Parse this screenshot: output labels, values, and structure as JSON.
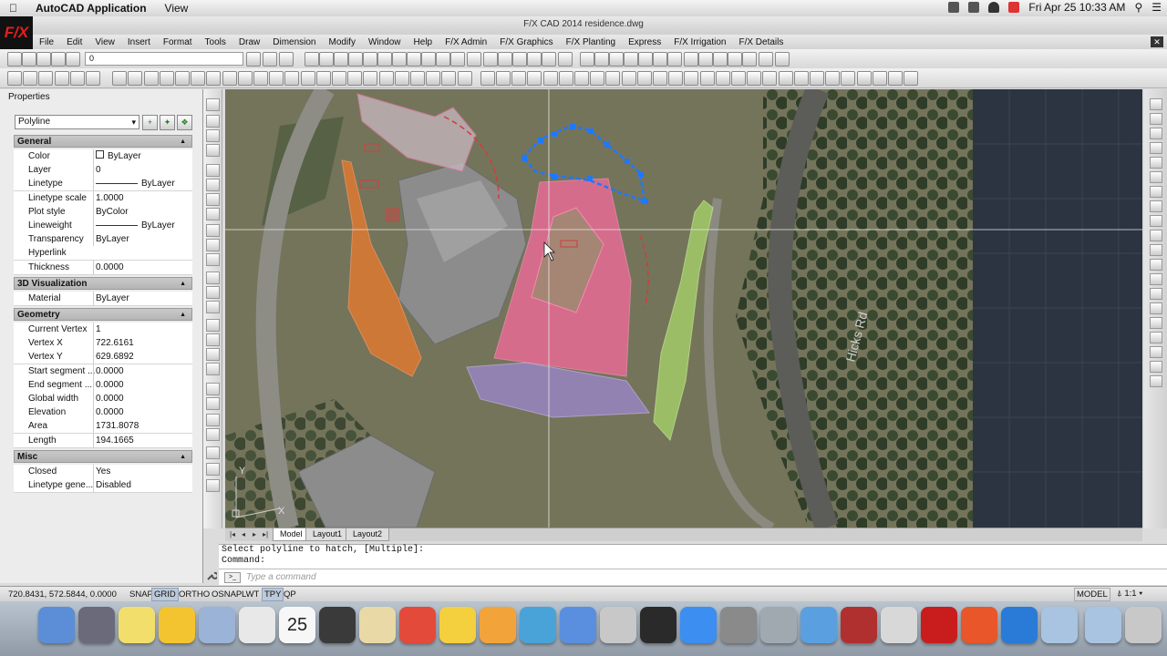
{
  "menubar": {
    "app_name": "AutoCAD Application",
    "view": "View",
    "clock": "Fri Apr 25  10:33 AM"
  },
  "window": {
    "title": "F/X CAD 2014    residence.dwg",
    "logo": "F/X"
  },
  "app_menu": [
    "File",
    "Edit",
    "View",
    "Insert",
    "Format",
    "Tools",
    "Draw",
    "Dimension",
    "Modify",
    "Window",
    "Help",
    "F/X Admin",
    "F/X Graphics",
    "F/X Planting",
    "Express",
    "F/X Irrigation",
    "F/X Details"
  ],
  "layer_toolbar": {
    "current_layer": "0"
  },
  "properties": {
    "title": "Properties",
    "object_type": "Polyline",
    "sections": [
      {
        "name": "General",
        "rows": [
          {
            "label": "Color",
            "value": "ByLayer"
          },
          {
            "label": "Layer",
            "value": "0"
          },
          {
            "label": "Linetype",
            "value": "ByLayer"
          },
          {
            "label": "Linetype scale",
            "value": "1.0000"
          },
          {
            "label": "Plot style",
            "value": "ByColor"
          },
          {
            "label": "Lineweight",
            "value": "ByLayer"
          },
          {
            "label": "Transparency",
            "value": "ByLayer"
          },
          {
            "label": "Hyperlink",
            "value": ""
          },
          {
            "label": "Thickness",
            "value": "0.0000"
          }
        ]
      },
      {
        "name": "3D Visualization",
        "rows": [
          {
            "label": "Material",
            "value": "ByLayer"
          }
        ]
      },
      {
        "name": "Geometry",
        "rows": [
          {
            "label": "Current Vertex",
            "value": "1"
          },
          {
            "label": "Vertex X",
            "value": "722.6161"
          },
          {
            "label": "Vertex Y",
            "value": "629.6892"
          },
          {
            "label": "Start segment ...",
            "value": "0.0000"
          },
          {
            "label": "End segment ...",
            "value": "0.0000"
          },
          {
            "label": "Global width",
            "value": "0.0000"
          },
          {
            "label": "Elevation",
            "value": "0.0000"
          },
          {
            "label": "Area",
            "value": "1731.8078"
          },
          {
            "label": "Length",
            "value": "194.1665"
          }
        ]
      },
      {
        "name": "Misc",
        "rows": [
          {
            "label": "Closed",
            "value": "Yes"
          },
          {
            "label": "Linetype gene...",
            "value": "Disabled"
          }
        ]
      }
    ]
  },
  "canvas": {
    "road_label": "Hicks Rd",
    "ucs_x": "X",
    "ucs_y": "Y"
  },
  "layout_tabs": [
    "Model",
    "Layout1",
    "Layout2"
  ],
  "command": {
    "history_1": "Select polyline to hatch, [Multiple]:",
    "history_2": "Command:",
    "placeholder": "Type a command"
  },
  "status": {
    "coords": "720.8431, 572.5844, 0.0000",
    "toggles": [
      {
        "label": "SNAP",
        "on": false
      },
      {
        "label": "GRID",
        "on": true
      },
      {
        "label": "ORTHO",
        "on": false
      },
      {
        "label": "OSNAP",
        "on": false
      },
      {
        "label": "LWT",
        "on": false
      },
      {
        "label": "TPY",
        "on": true
      },
      {
        "label": "QP",
        "on": false
      }
    ],
    "model": "MODEL",
    "annoscale": "1:1"
  },
  "dock_apps": [
    "finder",
    "launchpad",
    "stickies",
    "ichat",
    "preview",
    "chrome",
    "calendar",
    "ecto",
    "textedit",
    "sketchup",
    "rubber-duck",
    "ifx",
    "iphoto",
    "itunes",
    "dvd-player",
    "terminal",
    "app-store",
    "system-preferences",
    "network-utility",
    "remote-desktop",
    "photo-booth",
    "cad-utility",
    "fx-cad",
    "powerpoint",
    "windows",
    "documents",
    "downloads",
    "trash"
  ],
  "dock_calendar_day": "25",
  "colors": {
    "area_orange": "#f07a2a",
    "area_pink": "#ff6aa0",
    "area_purple": "#a088d8",
    "area_green": "#a8d66a",
    "selection_blue": "#1e78ff"
  }
}
